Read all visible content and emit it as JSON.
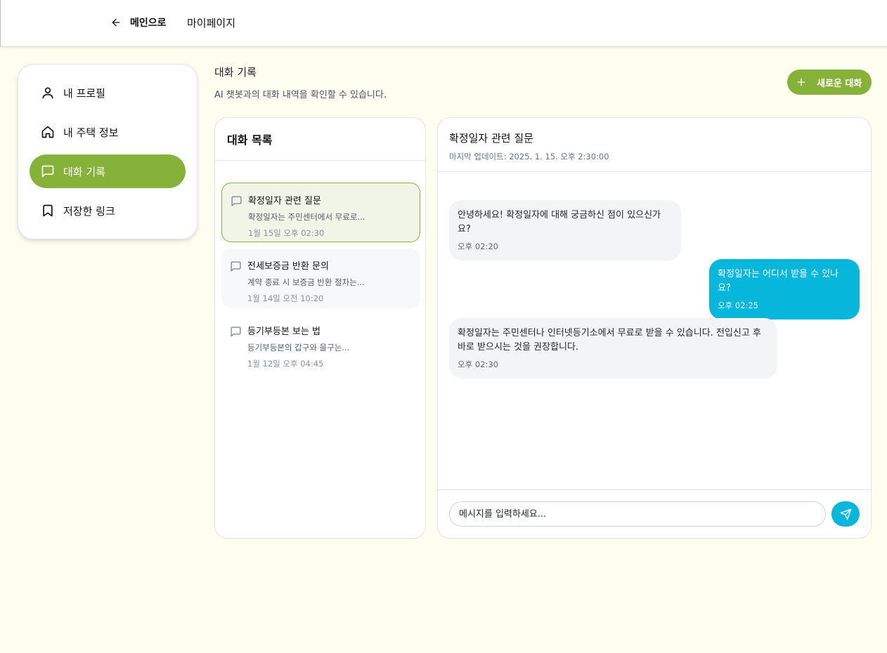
{
  "topnav": {
    "back_label": "메인으로",
    "mypage_label": "마이페이지"
  },
  "sidebar": {
    "items": [
      {
        "label": "내 프로필",
        "icon": "user-icon"
      },
      {
        "label": "내 주택 정보",
        "icon": "home-icon"
      },
      {
        "label": "대화 기록",
        "icon": "message-square-icon",
        "active": true
      },
      {
        "label": "저장한 링크",
        "icon": "bookmark-icon"
      }
    ]
  },
  "page": {
    "title": "대화 기록",
    "subtitle": "AI 챗봇과의 대화 내역을 확인할 수 있습니다.",
    "new_chat_label": "새로운 대화"
  },
  "conversation_list": {
    "heading": "대화 목록",
    "items": [
      {
        "title": "확정일자 관련 질문",
        "preview": "확정일자는 주민센터에서 무료로...",
        "time": "1월 15일 오후 02:30",
        "selected": true
      },
      {
        "title": "전세보증금 반환 문의",
        "preview": "계약 종료 시 보증금 반환 절차는...",
        "time": "1월 14일 오전 10:20"
      },
      {
        "title": "등기부등본 보는 법",
        "preview": "등기부등본의 갑구와 을구는...",
        "time": "1월 12일 오후 04:45"
      }
    ]
  },
  "chat": {
    "title": "확정일자 관련 질문",
    "updated": "마지막 업데이트: 2025. 1. 15. 오후 2:30:00",
    "messages": [
      {
        "role": "bot",
        "text": "안녕하세요! 확정일자에 대해 궁금하신 점이 있으신가요?",
        "time": "오후 02:20"
      },
      {
        "role": "user",
        "text": "확정일자는 어디서 받을 수 있나요?",
        "time": "오후 02:25"
      },
      {
        "role": "bot",
        "text": "확정일자는 주민센터나 인터넷등기소에서 무료로 받을 수 있습니다. 전입신고 후 바로 받으시는 것을 권장합니다.",
        "time": "오후 02:30"
      }
    ],
    "input_placeholder": "메시지를 입력하세요..."
  },
  "colors": {
    "accent_green": "#86b23a",
    "accent_cyan": "#06b6db",
    "page_background": "#fdfdf0"
  }
}
